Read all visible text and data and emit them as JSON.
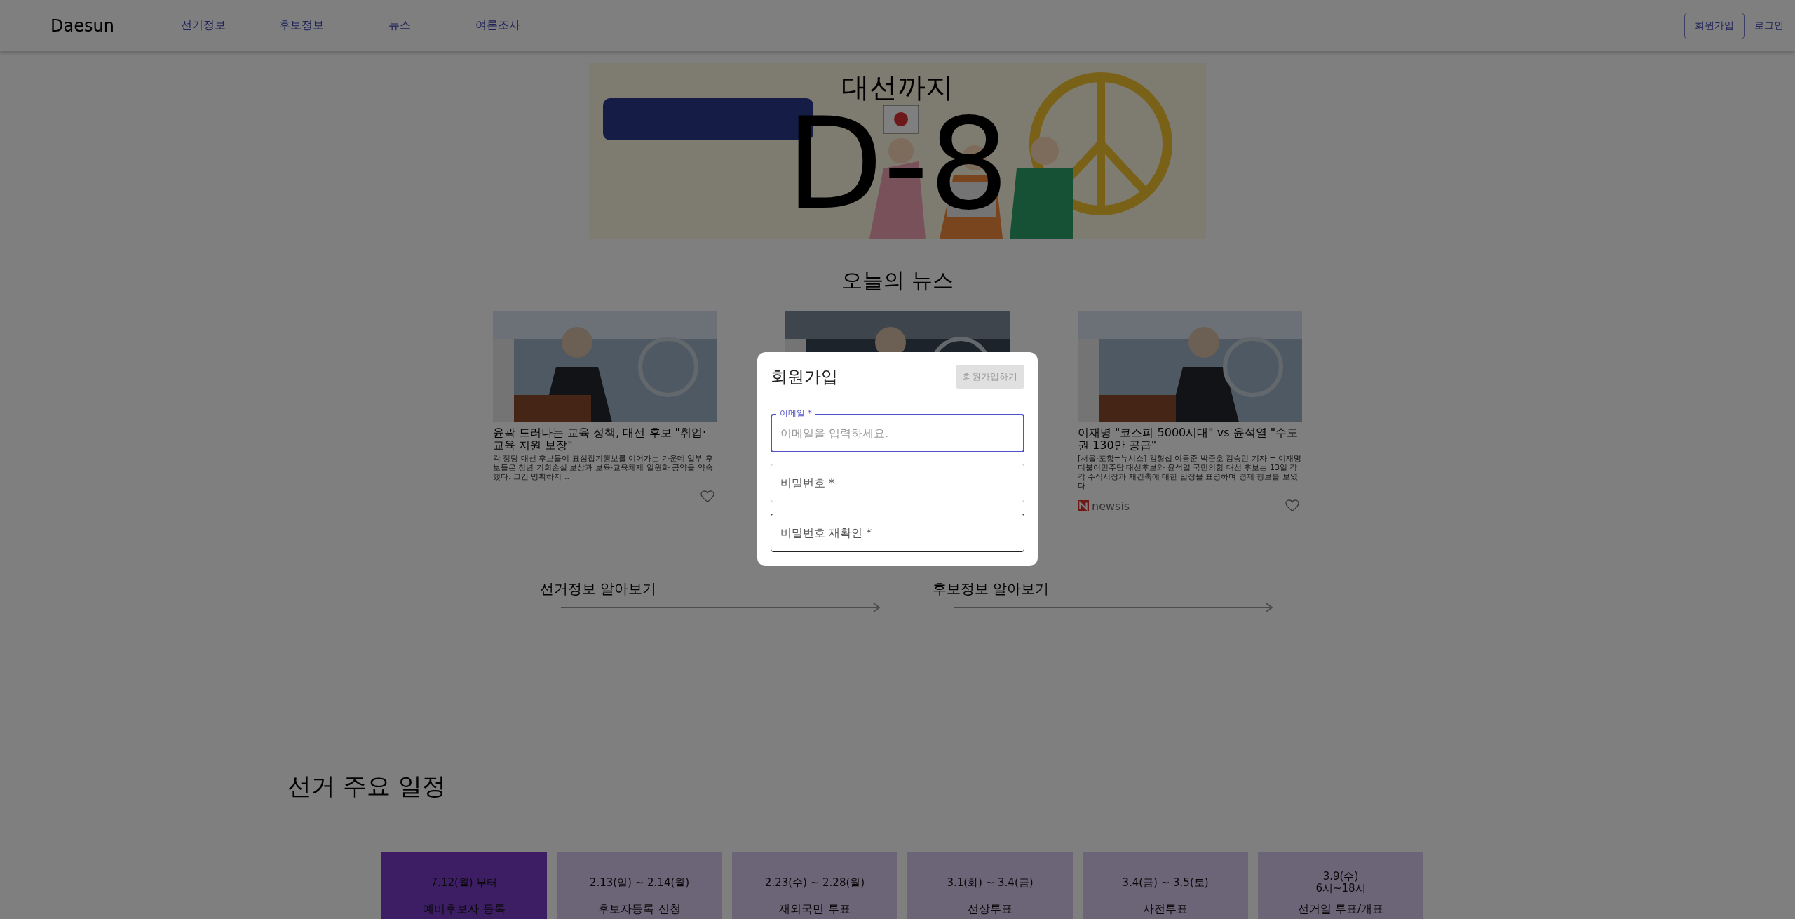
{
  "nav": {
    "logo": "Daesun",
    "links": [
      "선거정보",
      "후보정보",
      "뉴스",
      "여론조사"
    ],
    "signup": "회원가입",
    "login": "로그인"
  },
  "hero": {
    "caption": "대선까지",
    "countdown": "D-8"
  },
  "news": {
    "title": "오늘의 뉴스",
    "cards": [
      {
        "title": "윤곽 드러나는 교육 정책, 대선 후보 \"취업·교육 지원 보장\"",
        "summary": "각 정당 대선 후보들이 표심잡기행보를 이어가는 가운데 일부 후보들은 청년 기회손실 보상과 보육·교육체제 일원화 공약을 약속했다. 그간 명확하지 .."
      },
      {
        "kind": "picture"
      },
      {
        "title": "이재명 \"코스피 5000시대\" vs 윤석열 \"수도권 130만 공급\"",
        "summary": "[서울·포항=뉴시스] 김형섭 여동준 박준호 김승민 기자 = 이재명 더불어민주당 대선후보와 윤석열 국민의힘 대선 후보는 13일 각각 주식시장과 재건축에 대한 입장을 표명하며 경제 행보를 보였다",
        "source": "newsis"
      }
    ]
  },
  "explore_links": [
    "선거정보 알아보기",
    "후보정보 알아보기"
  ],
  "schedule": {
    "title": "선거 주요 일정",
    "items": [
      {
        "date": "7.12(월) 부터",
        "title": "예비후보자 등록",
        "selected": true
      },
      {
        "date": "2.13(일) ~ 2.14(월)",
        "title": "후보자등록 신청",
        "selected": false
      },
      {
        "date": "2.23(수) ~ 2.28(월)",
        "title": "재외국민 투표",
        "selected": false
      },
      {
        "date": "3.1(화) ~ 3.4(금)",
        "title": "선상투표",
        "selected": false
      },
      {
        "date": "3.4(금) ~ 3.5(토)",
        "title": "사전투표",
        "selected": false
      },
      {
        "date": "3.9(수)",
        "note": "6시~18시",
        "title": "선거일 투표/개표",
        "selected": false
      }
    ]
  },
  "modal": {
    "title": "회원가입",
    "submit": {
      "label": "회원가입하기",
      "disabled": true
    },
    "fields": [
      {
        "label": "이메일 *",
        "placeholder": "이메일을 입력하세요.",
        "focused": true,
        "hovered": false
      },
      {
        "label": "비밀번호 *",
        "focused": false,
        "hovered": false
      },
      {
        "label": "비밀번호 재확인 *",
        "focused": false,
        "hovered": true
      }
    ]
  }
}
